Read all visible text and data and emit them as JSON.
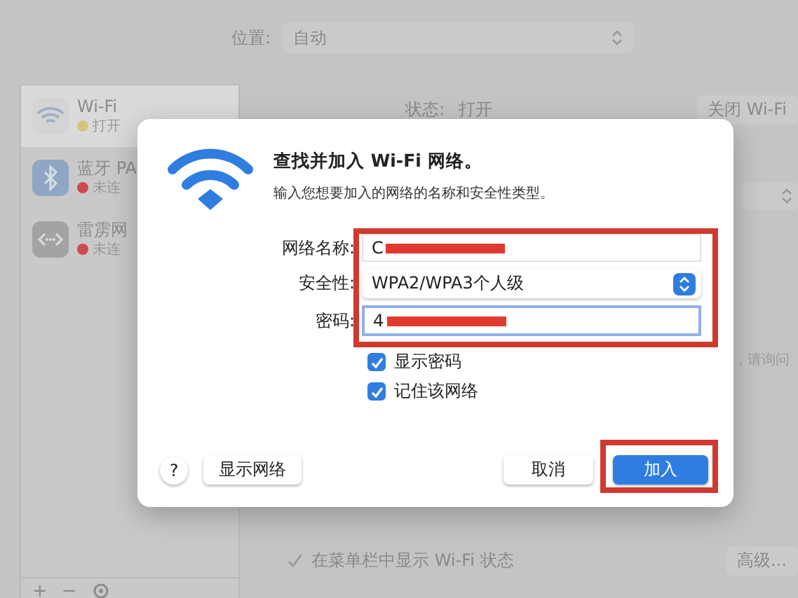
{
  "location": {
    "label": "位置:",
    "value": "自动"
  },
  "sidebar": {
    "items": [
      {
        "kind": "wifi",
        "name": "Wi-Fi",
        "status": "打开",
        "color": "#d9c27e",
        "selected": true
      },
      {
        "kind": "bluetooth",
        "name": "蓝牙 PA",
        "status": "未连",
        "color": "#cf4a4f",
        "selected": false
      },
      {
        "kind": "bridge",
        "name": "雷雳网",
        "status": "未连",
        "color": "#cf4a4f",
        "selected": false
      }
    ],
    "add": "+",
    "remove": "−"
  },
  "status": {
    "label": "状态:",
    "value": "打开",
    "button": "关闭 Wi-Fi"
  },
  "hint": "，请询问",
  "menu_bar_option": {
    "label": "在菜单栏中显示 Wi-Fi 状态",
    "checked": true
  },
  "advanced_button": "高级...",
  "dialog": {
    "title": "查找并加入 Wi-Fi 网络。",
    "subtitle": "输入您想要加入的网络的名称和安全性类型。",
    "fields": [
      {
        "kind": "text",
        "label": "网络名称:",
        "value": "C",
        "redacted": true,
        "focused": false
      },
      {
        "kind": "select",
        "label": "安全性:",
        "value": "WPA2/WPA3个人级"
      },
      {
        "kind": "text",
        "label": "密码:",
        "value": "4",
        "redacted": true,
        "focused": true
      }
    ],
    "checkboxes": [
      {
        "label": "显示密码",
        "checked": true
      },
      {
        "label": "记住该网络",
        "checked": true
      }
    ],
    "help": "?",
    "buttons": [
      {
        "label": "显示网络",
        "kind": "normal"
      },
      {
        "label": "取消",
        "kind": "normal"
      },
      {
        "label": "加入",
        "kind": "default"
      }
    ]
  }
}
